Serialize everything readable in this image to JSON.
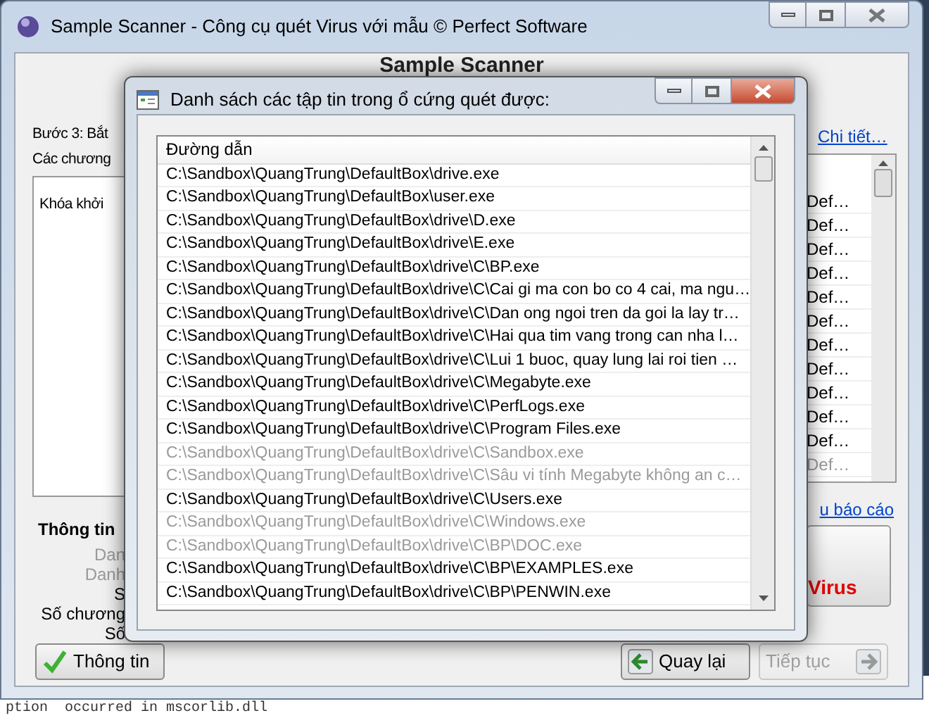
{
  "main_window": {
    "title": "Sample Scanner - Công cụ quét Virus với mẫu © Perfect Software",
    "heading": "Sample Scanner",
    "left_fragments": {
      "group_label": "Bước 3: Bắt",
      "list_label": "Các chương",
      "column_1": "Khóa khởi",
      "info_heading": "Thông tin",
      "info_lines": [
        {
          "text": "Dan",
          "greyed": true
        },
        {
          "text": "Danh",
          "greyed": true
        },
        {
          "text": "S",
          "greyed": false
        },
        {
          "text": "Số chương",
          "greyed": false
        },
        {
          "text": "Số",
          "greyed": false
        }
      ]
    },
    "details_link": "Chi tiết…",
    "right_cells": [
      {
        "text": "Def…",
        "greyed": false
      },
      {
        "text": "Def…",
        "greyed": false
      },
      {
        "text": "Def…",
        "greyed": false
      },
      {
        "text": "Def…",
        "greyed": false
      },
      {
        "text": "Def…",
        "greyed": false
      },
      {
        "text": "Def…",
        "greyed": false
      },
      {
        "text": "Def…",
        "greyed": false
      },
      {
        "text": "Def…",
        "greyed": false
      },
      {
        "text": "Def…",
        "greyed": false
      },
      {
        "text": "Def…",
        "greyed": false
      },
      {
        "text": "Def…",
        "greyed": false
      },
      {
        "text": "Def…",
        "greyed": true
      }
    ],
    "report_link": "u báo cáo",
    "virus_button": "Virus",
    "buttons": [
      {
        "label": "Thông tin",
        "kind": "info",
        "disabled": false
      },
      {
        "label": "Quay lại",
        "kind": "back",
        "disabled": false
      },
      {
        "label": "Tiếp tục",
        "kind": "next",
        "disabled": true
      }
    ]
  },
  "dialog": {
    "title": "Danh sách các tập tin trong ổ cứng quét được:",
    "column": "Đường dẫn",
    "rows": [
      {
        "path": "C:\\Sandbox\\QuangTrung\\DefaultBox\\drive.exe",
        "greyed": false
      },
      {
        "path": "C:\\Sandbox\\QuangTrung\\DefaultBox\\user.exe",
        "greyed": false
      },
      {
        "path": "C:\\Sandbox\\QuangTrung\\DefaultBox\\drive\\D.exe",
        "greyed": false
      },
      {
        "path": "C:\\Sandbox\\QuangTrung\\DefaultBox\\drive\\E.exe",
        "greyed": false
      },
      {
        "path": "C:\\Sandbox\\QuangTrung\\DefaultBox\\drive\\C\\BP.exe",
        "greyed": false
      },
      {
        "path": "C:\\Sandbox\\QuangTrung\\DefaultBox\\drive\\C\\Cai gi ma con bo co 4 cai, ma ngu…",
        "greyed": false
      },
      {
        "path": "C:\\Sandbox\\QuangTrung\\DefaultBox\\drive\\C\\Dan ong ngoi tren da goi la lay tr…",
        "greyed": false
      },
      {
        "path": "C:\\Sandbox\\QuangTrung\\DefaultBox\\drive\\C\\Hai qua tim vang trong can nha l…",
        "greyed": false
      },
      {
        "path": "C:\\Sandbox\\QuangTrung\\DefaultBox\\drive\\C\\Lui 1 buoc, quay lung lai roi tien …",
        "greyed": false
      },
      {
        "path": "C:\\Sandbox\\QuangTrung\\DefaultBox\\drive\\C\\Megabyte.exe",
        "greyed": false
      },
      {
        "path": "C:\\Sandbox\\QuangTrung\\DefaultBox\\drive\\C\\PerfLogs.exe",
        "greyed": false
      },
      {
        "path": "C:\\Sandbox\\QuangTrung\\DefaultBox\\drive\\C\\Program Files.exe",
        "greyed": false
      },
      {
        "path": "C:\\Sandbox\\QuangTrung\\DefaultBox\\drive\\C\\Sandbox.exe",
        "greyed": true
      },
      {
        "path": "C:\\Sandbox\\QuangTrung\\DefaultBox\\drive\\C\\Sâu vi tính Megabyte không an c…",
        "greyed": true
      },
      {
        "path": "C:\\Sandbox\\QuangTrung\\DefaultBox\\drive\\C\\Users.exe",
        "greyed": false
      },
      {
        "path": "C:\\Sandbox\\QuangTrung\\DefaultBox\\drive\\C\\Windows.exe",
        "greyed": true
      },
      {
        "path": "C:\\Sandbox\\QuangTrung\\DefaultBox\\drive\\C\\BP\\DOC.exe",
        "greyed": true
      },
      {
        "path": "C:\\Sandbox\\QuangTrung\\DefaultBox\\drive\\C\\BP\\EXAMPLES.exe",
        "greyed": false
      },
      {
        "path": "C:\\Sandbox\\QuangTrung\\DefaultBox\\drive\\C\\BP\\PENWIN.exe",
        "greyed": false
      }
    ]
  },
  "background_text": "ption  occurred in mscorlib.dll"
}
